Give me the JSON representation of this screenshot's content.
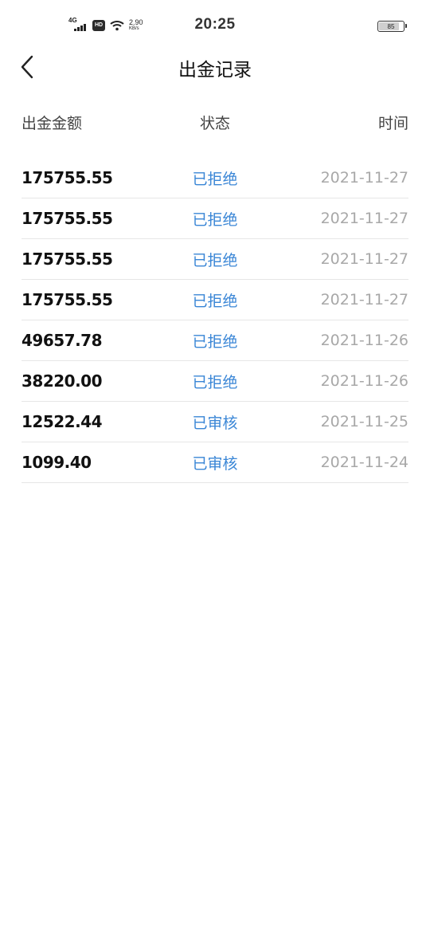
{
  "status_bar": {
    "network": "4G",
    "hd": "HD",
    "speed_value": "2.90",
    "speed_unit": "KB/s",
    "time": "20:25",
    "battery": "85",
    "battery_level_percent": 85
  },
  "header": {
    "title": "出金记录"
  },
  "table": {
    "columns": [
      "出金金额",
      "状态",
      "时间"
    ],
    "rows": [
      {
        "amount": "175755.55",
        "status": "已拒绝",
        "date": "2021-11-27"
      },
      {
        "amount": "175755.55",
        "status": "已拒绝",
        "date": "2021-11-27"
      },
      {
        "amount": "175755.55",
        "status": "已拒绝",
        "date": "2021-11-27"
      },
      {
        "amount": "175755.55",
        "status": "已拒绝",
        "date": "2021-11-27"
      },
      {
        "amount": "49657.78",
        "status": "已拒绝",
        "date": "2021-11-26"
      },
      {
        "amount": "38220.00",
        "status": "已拒绝",
        "date": "2021-11-26"
      },
      {
        "amount": "12522.44",
        "status": "已审核",
        "date": "2021-11-25"
      },
      {
        "amount": "1099.40",
        "status": "已审核",
        "date": "2021-11-24"
      }
    ]
  },
  "colors": {
    "status_text": "#3a86d6",
    "date_text": "#a8a8a8",
    "divider": "#e6e6e6"
  }
}
